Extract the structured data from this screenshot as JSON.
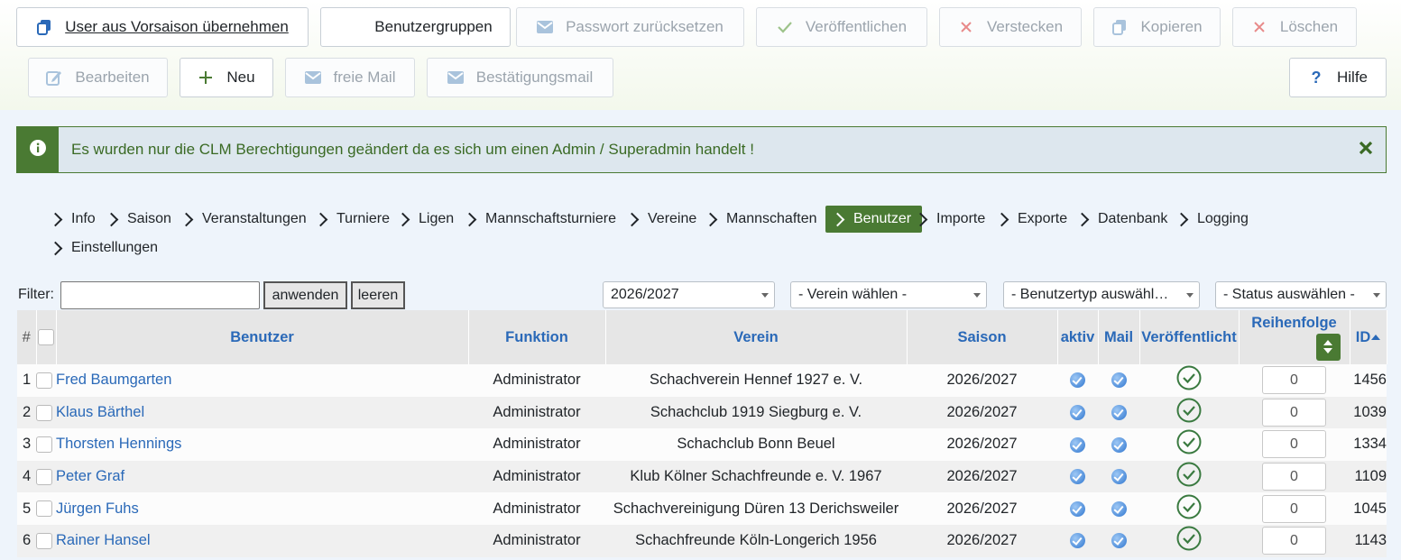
{
  "toolbar": {
    "row1": [
      {
        "label": "User aus Vorsaison übernehmen",
        "icon": "copy-icon",
        "disabled": false
      },
      {
        "label": "Benutzergruppen",
        "icon": "",
        "disabled": false
      },
      {
        "label": "Passwort zurücksetzen",
        "icon": "mail-icon",
        "disabled": true
      },
      {
        "label": "Veröffentlichen",
        "icon": "check-icon",
        "disabled": true
      },
      {
        "label": "Verstecken",
        "icon": "times-icon",
        "disabled": true
      },
      {
        "label": "Kopieren",
        "icon": "copy-icon",
        "disabled": true
      },
      {
        "label": "Löschen",
        "icon": "times-icon",
        "disabled": true
      }
    ],
    "row2": [
      {
        "label": "Bearbeiten",
        "icon": "edit-icon",
        "disabled": true
      },
      {
        "label": "Neu",
        "icon": "plus-icon",
        "disabled": false
      },
      {
        "label": "freie Mail",
        "icon": "mail-icon",
        "disabled": true
      },
      {
        "label": "Bestätigungsmail",
        "icon": "mail-icon",
        "disabled": true
      }
    ],
    "help": {
      "label": "Hilfe",
      "icon": "question-icon"
    }
  },
  "alert": {
    "message": "Es wurden nur die CLM Berechtigungen geändert da es sich um einen Admin / Superadmin handelt !"
  },
  "nav": [
    {
      "label": "Info"
    },
    {
      "label": "Saison"
    },
    {
      "label": "Veranstaltungen"
    },
    {
      "label": "Turniere"
    },
    {
      "label": "Ligen"
    },
    {
      "label": "Mannschaftsturniere"
    },
    {
      "label": "Vereine"
    },
    {
      "label": "Mannschaften"
    },
    {
      "label": "Benutzer",
      "active": true
    },
    {
      "label": "Importe"
    },
    {
      "label": "Exporte"
    },
    {
      "label": "Datenbank"
    },
    {
      "label": "Logging"
    },
    {
      "label": "Einstellungen"
    }
  ],
  "filter": {
    "label": "Filter:",
    "value": "",
    "apply": "anwenden",
    "clear": "leeren",
    "season": "2026/2027",
    "club": "- Verein wählen -",
    "usertype": "- Benutzertyp auswähl…",
    "status": "- Status auswählen -"
  },
  "table": {
    "headers": {
      "num": "#",
      "user": "Benutzer",
      "function": "Funktion",
      "club": "Verein",
      "season": "Saison",
      "active": "aktiv",
      "mail": "Mail",
      "published": "Veröffentlicht",
      "order": "Reihenfolge",
      "id": "ID"
    },
    "rows": [
      {
        "n": "1",
        "user": "Fred Baumgarten",
        "function": "Administrator",
        "club": "Schachverein Hennef 1927 e. V.",
        "season": "2026/2027",
        "order": "0",
        "id": "1456"
      },
      {
        "n": "2",
        "user": "Klaus Bärthel",
        "function": "Administrator",
        "club": "Schachclub 1919 Siegburg e. V.",
        "season": "2026/2027",
        "order": "0",
        "id": "1039"
      },
      {
        "n": "3",
        "user": "Thorsten Hennings",
        "function": "Administrator",
        "club": "Schachclub Bonn Beuel",
        "season": "2026/2027",
        "order": "0",
        "id": "1334"
      },
      {
        "n": "4",
        "user": "Peter Graf",
        "function": "Administrator",
        "club": "Klub Kölner Schachfreunde e. V. 1967",
        "season": "2026/2027",
        "order": "0",
        "id": "1109"
      },
      {
        "n": "5",
        "user": "Jürgen Fuhs",
        "function": "Administrator",
        "club": "Schachvereinigung Düren 13 Derichsweiler",
        "season": "2026/2027",
        "order": "0",
        "id": "1045"
      },
      {
        "n": "6",
        "user": "Rainer Hansel",
        "function": "Administrator",
        "club": "Schachfreunde Köln-Longerich 1956",
        "season": "2026/2027",
        "order": "0",
        "id": "1143"
      }
    ]
  },
  "colors": {
    "brand": "#4a7a33",
    "link": "#2a69b8"
  }
}
